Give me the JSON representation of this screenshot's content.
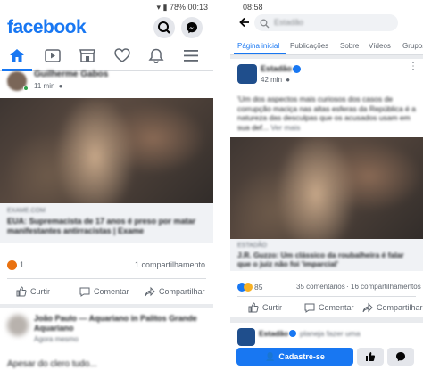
{
  "left": {
    "status": {
      "right_text": "78% 00:13"
    },
    "app_title": "facebook",
    "post1": {
      "author": "Guilherme Gabos",
      "time": "11 min",
      "link_source": "EXAME.COM",
      "link_title": "EUA: Supremacista de 17 anos é preso por matar manifestantes antirracistas | Exame",
      "share_count": "1 compartilhamento",
      "reaction_count": "1",
      "actions": {
        "like": "Curtir",
        "comment": "Comentar",
        "share": "Compartilhar"
      }
    },
    "post2": {
      "author": "João Paulo — Aquariano in Palitos Grande Aquariano",
      "subtitle": "Agora mesmo",
      "body": "Apesar do clero tudo..."
    }
  },
  "right": {
    "status": {
      "time": "08:58"
    },
    "search_placeholder": "Estadão",
    "tabs": [
      "Página inicial",
      "Publicações",
      "Sobre",
      "Vídeos",
      "Grupos"
    ],
    "post": {
      "page_name": "Estadão",
      "time": "42 min",
      "text": "'Um dos aspectos mais curiosos dos casos de corrupção maciça nas altas esferas da República é a natureza das desculpas que os acusados usam em sua def...",
      "see_more": "Ver mais",
      "link_source": "ESTADÃO",
      "link_title": "J.R. Guzzo: Um clássico da roubalheira é falar que o juiz não foi 'imparcial'",
      "reaction_count": "85",
      "comments": "35 comentários",
      "shares": "16 compartilhamentos",
      "actions": {
        "like": "Curtir",
        "comment": "Comentar",
        "share": "Compartilhar"
      }
    },
    "post2": {
      "page_name": "Estadão",
      "text": "planeja fazer uma"
    },
    "signup_button": "Cadastre-se"
  },
  "colors": {
    "facebook_blue": "#1877f2",
    "signup_blue": "#1877f2"
  }
}
